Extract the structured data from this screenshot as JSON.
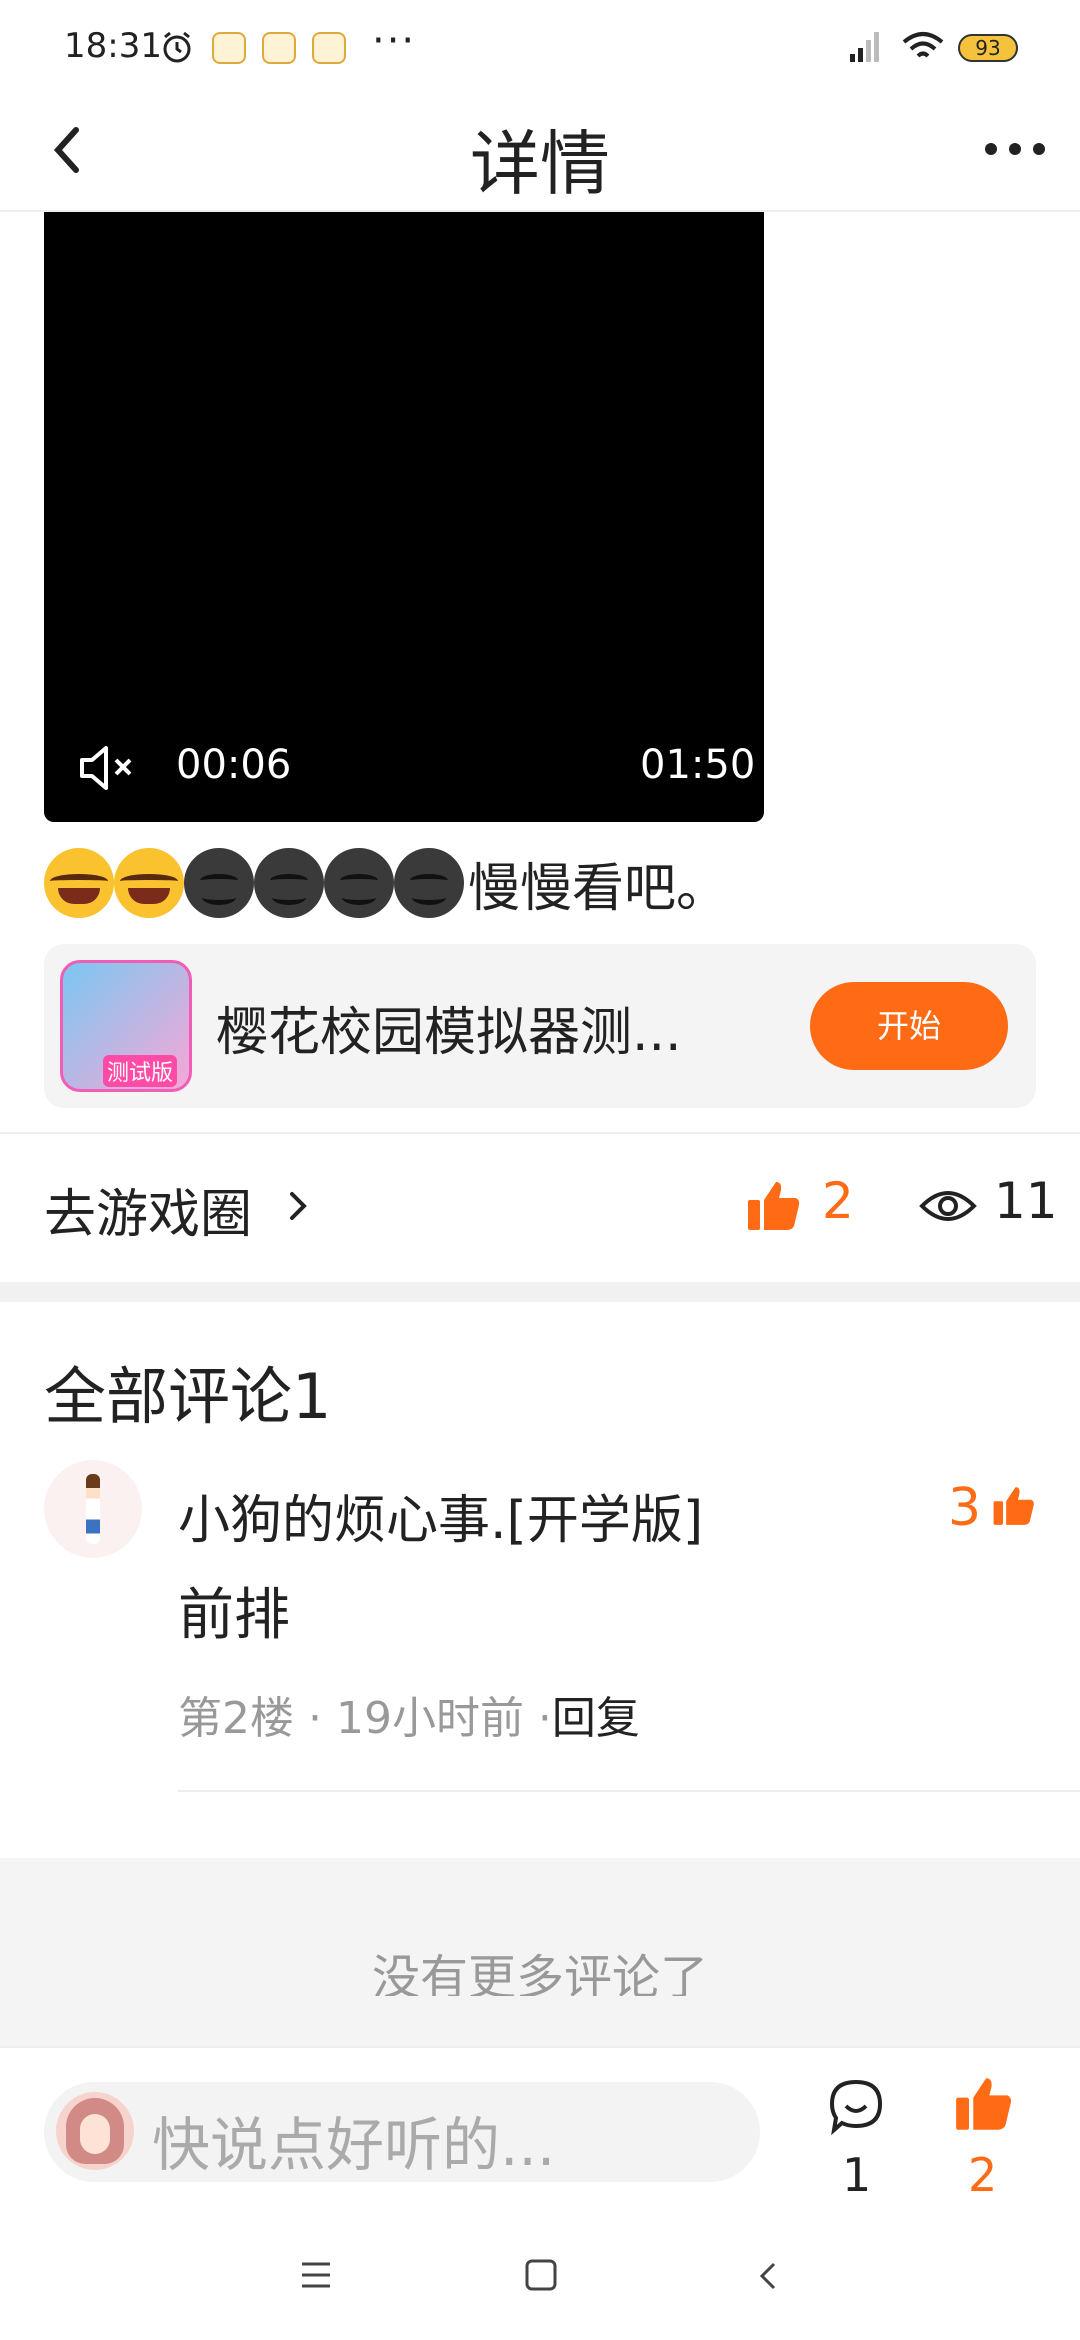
{
  "status_bar": {
    "time": "18:31",
    "battery": "93",
    "more": "···"
  },
  "header": {
    "title": "详情"
  },
  "video": {
    "current_time": "00:06",
    "duration": "01:50"
  },
  "post": {
    "text": "慢慢看吧。",
    "emoji": [
      "laugh-cry",
      "laugh-cry",
      "smirk",
      "smirk",
      "smirk",
      "smirk"
    ]
  },
  "game_card": {
    "name": "樱花校园模拟器测...",
    "badge": "测试版",
    "start_label": "开始"
  },
  "stats": {
    "circle_link": "去游戏圈",
    "likes": "2",
    "views": "11"
  },
  "comments": {
    "title": "全部评论1",
    "items": [
      {
        "user": "小狗的烦心事.[开学版]",
        "likes": "3",
        "text": "前排",
        "meta": "第2楼 · 19小时前 ·",
        "reply_label": "回复"
      }
    ],
    "no_more": "没有更多评论了"
  },
  "input_bar": {
    "placeholder": "快说点好听的...",
    "comment_count": "1",
    "like_count": "2"
  },
  "colors": {
    "accent": "#ff6a14",
    "background": "#ffffff",
    "muted": "#999999"
  }
}
